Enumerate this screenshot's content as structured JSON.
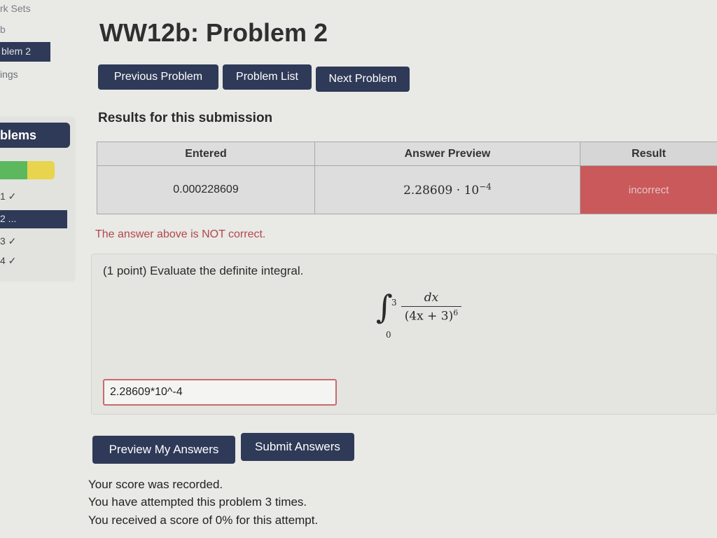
{
  "sidebar": {
    "links": [
      "rk Sets",
      "b",
      "ings"
    ],
    "active_link": "blem 2",
    "problems_button": "blems",
    "progress": {
      "correct_fraction": 0.5
    },
    "problems": [
      {
        "label": "1 ✓"
      },
      {
        "label": "2 ..."
      },
      {
        "label": "3 ✓"
      },
      {
        "label": "4 ✓"
      }
    ]
  },
  "page": {
    "title": "WW12b: Problem 2"
  },
  "nav": {
    "previous": "Previous Problem",
    "list": "Problem List",
    "next": "Next Problem"
  },
  "results": {
    "heading": "Results for this submission",
    "columns": [
      "Entered",
      "Answer Preview",
      "Result"
    ],
    "row": {
      "entered": "0.000228609",
      "preview_base": "2.28609 · 10",
      "preview_exp": "−4",
      "result": "incorrect"
    },
    "message": "The answer above is NOT correct."
  },
  "problem": {
    "text": "(1 point) Evaluate the definite integral.",
    "integral": {
      "upper": "3",
      "lower": "0",
      "numerator": "dx",
      "denominator": "(4x + 3)",
      "denominator_exp": "6"
    },
    "answer_value": "2.28609*10^-4"
  },
  "actions": {
    "preview": "Preview My Answers",
    "submit": "Submit Answers"
  },
  "score": {
    "lines": [
      "Your score was recorded.",
      "You have attempted this problem 3 times.",
      "You received a score of 0% for this attempt."
    ]
  },
  "colors": {
    "primary": "#2e3a57",
    "incorrect": "#c9595b",
    "error_text": "#b2474a",
    "progress_green": "#5cb85c",
    "progress_yellow": "#e8d44d"
  }
}
